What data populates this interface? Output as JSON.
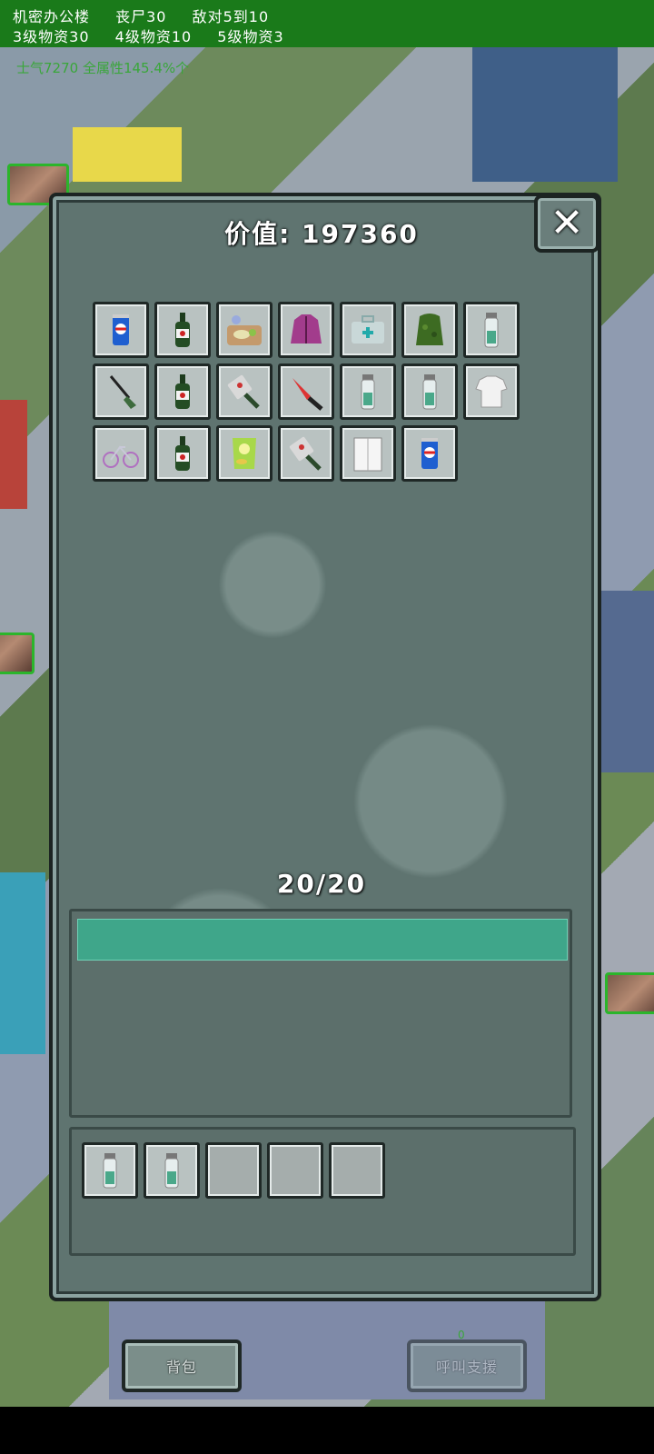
{
  "hud": {
    "location": "机密办公楼",
    "zombies": "丧尸30",
    "enemies": "敌对5到10",
    "tier3": "3级物资30",
    "tier4": "4级物资10",
    "tier5": "5级物资3",
    "morale": "士气7270  全属性145.4%个"
  },
  "panel": {
    "value_label": "价值: 197360",
    "close_symbol": "✕",
    "capacity_text": "20/20",
    "capacity_fraction": 1.0,
    "loot_items": [
      {
        "icon": "soda-can-icon"
      },
      {
        "icon": "beer-bottle-icon"
      },
      {
        "icon": "food-tray-icon"
      },
      {
        "icon": "purple-jacket-icon"
      },
      {
        "icon": "medkit-icon"
      },
      {
        "icon": "ghillie-suit-icon"
      },
      {
        "icon": "vial-icon"
      },
      {
        "icon": "shovel-icon"
      },
      {
        "icon": "beer-bottle-icon"
      },
      {
        "icon": "cleaver-icon"
      },
      {
        "icon": "knife-icon"
      },
      {
        "icon": "vial-icon"
      },
      {
        "icon": "vial-icon"
      },
      {
        "icon": "white-shirt-icon"
      },
      {
        "icon": "bicycle-icon"
      },
      {
        "icon": "beer-bottle-icon"
      },
      {
        "icon": "chips-bag-icon"
      },
      {
        "icon": "cleaver-icon"
      },
      {
        "icon": "book-icon"
      },
      {
        "icon": "soda-can-icon"
      }
    ],
    "carry_slots": [
      {
        "icon": "vial-icon"
      },
      {
        "icon": "vial-icon"
      },
      {
        "icon": ""
      },
      {
        "icon": ""
      },
      {
        "icon": ""
      }
    ]
  },
  "buttons": {
    "backpack": "背包",
    "call_support": "呼叫支援",
    "support_counter": "0"
  }
}
